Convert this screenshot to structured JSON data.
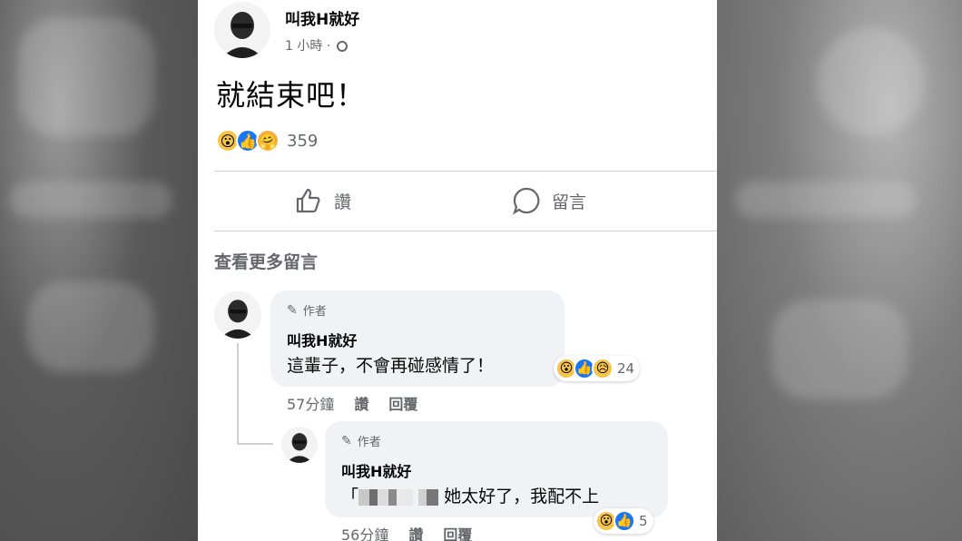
{
  "post": {
    "author": "叫我H就好",
    "time": "1 小時 · ",
    "text": "就結束吧！",
    "reaction_count": "359",
    "reactions": [
      "wow",
      "like",
      "care"
    ],
    "actions": {
      "like": "讚",
      "comment": "留言"
    },
    "view_more_comments": "查看更多留言"
  },
  "comments": [
    {
      "author_badge": "作者",
      "author": "叫我H就好",
      "text": "這輩子，不會再碰感情了！",
      "reactions": [
        "wow",
        "like",
        "sad"
      ],
      "reaction_count": "24",
      "time": "57分鐘",
      "like": "讚",
      "reply": "回覆"
    },
    {
      "author_badge": "作者",
      "author": "叫我H就好",
      "text_prefix": "「",
      "text": "她太好了，我配不上",
      "reactions": [
        "wow",
        "like"
      ],
      "reaction_count": "5",
      "time": "56分鐘",
      "like": "讚",
      "reply": "回覆"
    }
  ],
  "colors": {
    "accent": "#1877f2",
    "secondary_text": "#65676b",
    "bubble": "#f0f2f5"
  }
}
